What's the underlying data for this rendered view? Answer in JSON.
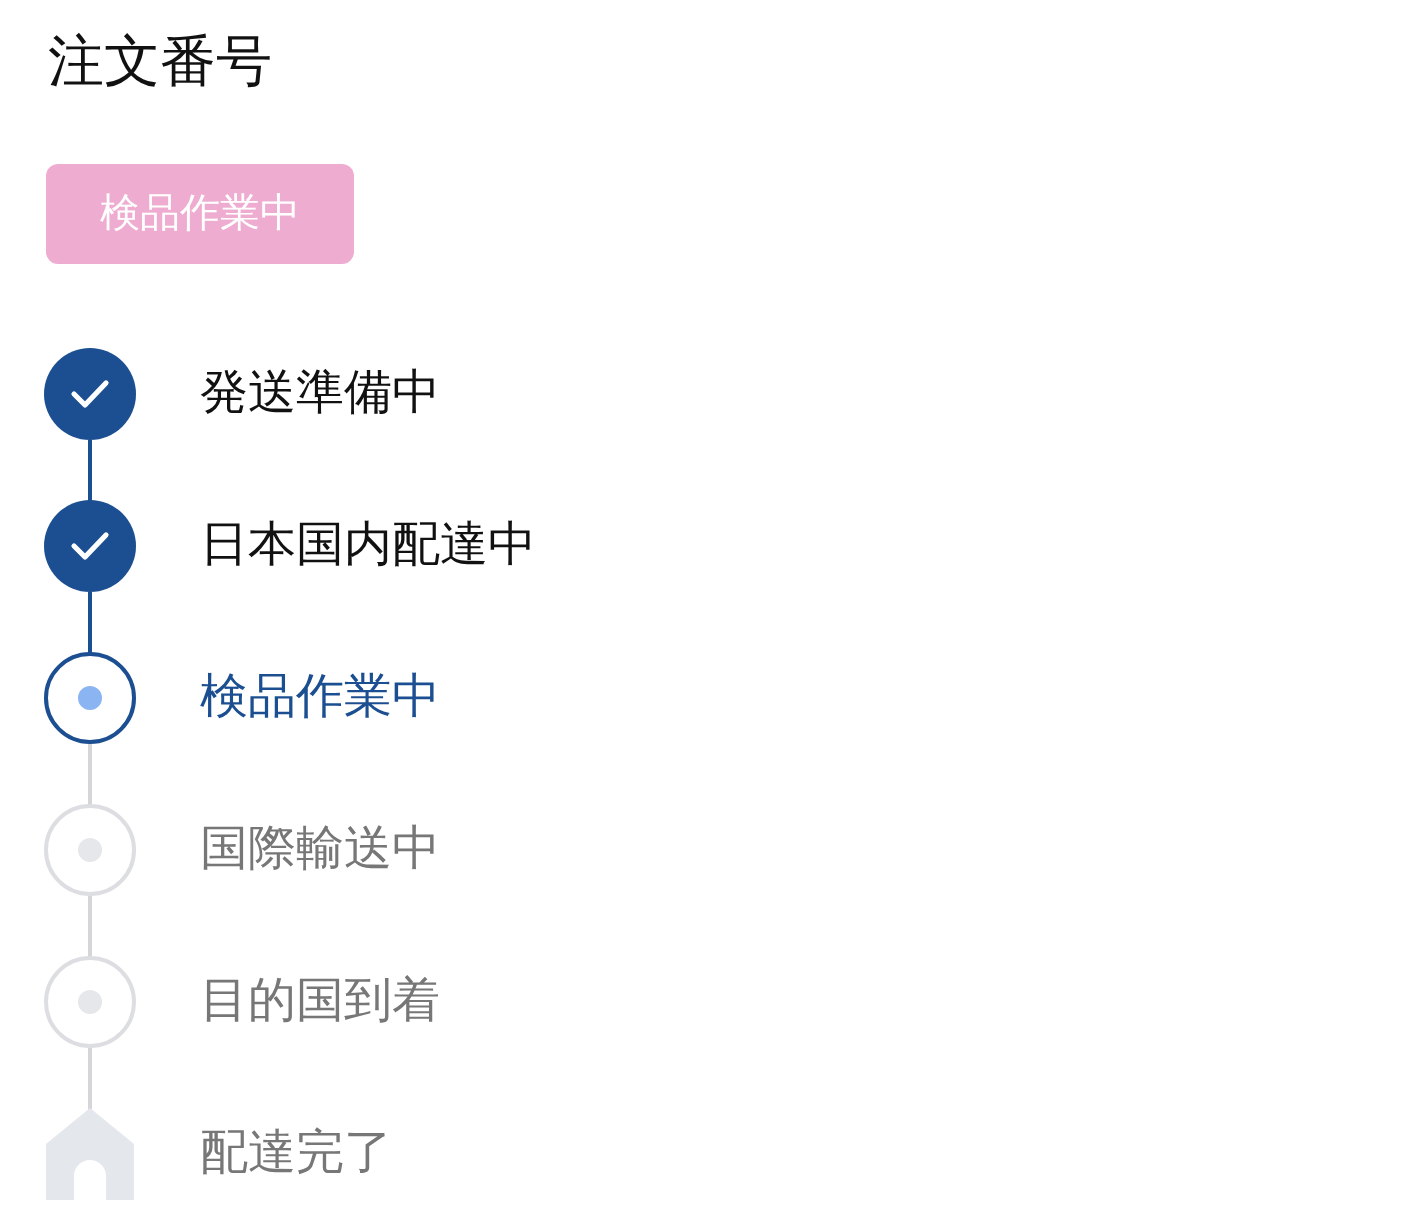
{
  "title": "注文番号",
  "status_badge": "検品作業中",
  "steps": [
    {
      "label": "発送準備中",
      "completed": true,
      "selected": false,
      "kind": "step"
    },
    {
      "label": "日本国内配達中",
      "completed": true,
      "selected": false,
      "kind": "step"
    },
    {
      "label": "検品作業中",
      "completed": false,
      "selected": true,
      "kind": "step"
    },
    {
      "label": "国際輸送中",
      "completed": false,
      "selected": false,
      "kind": "step"
    },
    {
      "label": "目的国到着",
      "completed": false,
      "selected": false,
      "kind": "step"
    },
    {
      "label": "配達完了",
      "completed": false,
      "selected": false,
      "kind": "destination"
    }
  ]
}
